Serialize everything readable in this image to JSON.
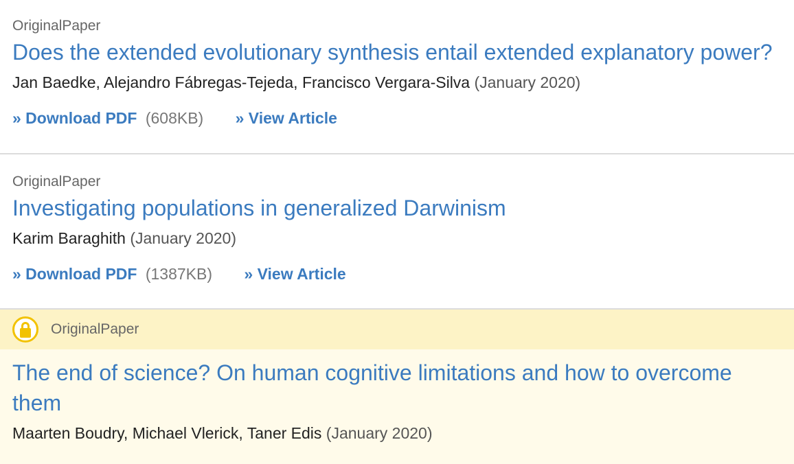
{
  "results": [
    {
      "type": "OriginalPaper",
      "title": "Does the extended evolutionary synthesis entail extended explanatory power?",
      "authors": "Jan Baedke, Alejandro Fábregas-Tejeda, Francisco Vergara-Silva",
      "date": "(January 2020)",
      "download_label": "» Download PDF",
      "size": "(608KB)",
      "view_label": "» View Article"
    },
    {
      "type": "OriginalPaper",
      "title": "Investigating populations in generalized Darwinism",
      "authors": "Karim Baraghith",
      "date": "(January 2020)",
      "download_label": "» Download PDF",
      "size": "(1387KB)",
      "view_label": "» View Article"
    },
    {
      "type": "OriginalPaper",
      "access_icon": "lock-icon",
      "title": "The end of science? On human cognitive limitations and how to overcome them",
      "authors": "Maarten Boudry, Michael Vlerick, Taner Edis",
      "date": "(January 2020)"
    }
  ],
  "colors": {
    "link": "#3b7bbf",
    "restricted_bar": "#fdf3c6",
    "restricted_bg": "#fffbea",
    "lock": "#f2c200"
  }
}
